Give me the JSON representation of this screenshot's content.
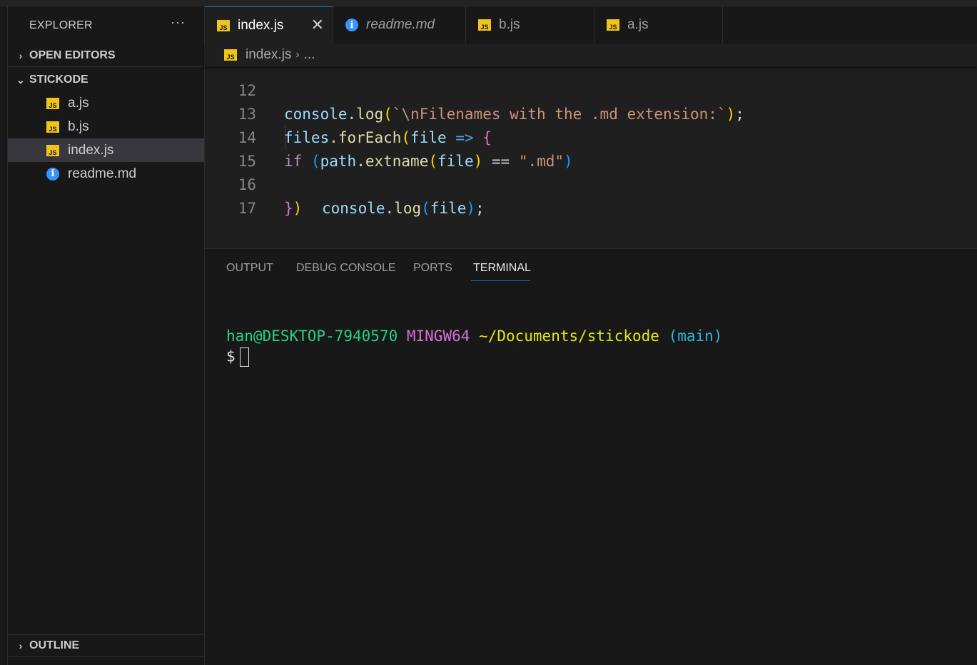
{
  "sidebar": {
    "title": "EXPLORER",
    "more_label": "···",
    "sections": {
      "open_editors": "OPEN EDITORS",
      "folder": "STICKODE",
      "outline": "OUTLINE"
    },
    "files": [
      {
        "name": "a.js",
        "type": "js",
        "selected": false
      },
      {
        "name": "b.js",
        "type": "js",
        "selected": false
      },
      {
        "name": "index.js",
        "type": "js",
        "selected": true
      },
      {
        "name": "readme.md",
        "type": "info",
        "selected": false
      }
    ]
  },
  "tabs": [
    {
      "label": "index.js",
      "icon": "js-file-icon",
      "active": true
    },
    {
      "label": "readme.md",
      "icon": "info-icon",
      "active": false
    },
    {
      "label": "b.js",
      "icon": "js-file-icon",
      "active": false
    },
    {
      "label": "a.js",
      "icon": "js-file-icon",
      "active": false
    }
  ],
  "icons": {
    "js": "JS",
    "info": "i",
    "close": "✕",
    "chevron_right": "›",
    "chevron_down": "⌄"
  },
  "breadcrumb": {
    "file": "index.js",
    "separator": "›",
    "more": "..."
  },
  "editor": {
    "lines": [
      {
        "n": "12",
        "text": "console.log(`\\nFilenames with the .md extension:`);"
      },
      {
        "n": "13",
        "text": "files.forEach(file => {"
      },
      {
        "n": "14",
        "text": "if (path.extname(file) == \".md\")"
      },
      {
        "n": "15",
        "text": "console.log(file);"
      },
      {
        "n": "16",
        "text": "})"
      },
      {
        "n": "17",
        "text": ""
      }
    ]
  },
  "panel": {
    "tabs": [
      "OUTPUT",
      "DEBUG CONSOLE",
      "PORTS",
      "TERMINAL"
    ],
    "active_tab": "TERMINAL",
    "terminal": {
      "user": "han@DESKTOP-7940570",
      "host": "MINGW64",
      "path": "~/Documents/stickode",
      "branch": "(main)",
      "prompt": "$"
    }
  },
  "colors": {
    "accent": "#0078d4",
    "js_icon": "#f0c419",
    "info_icon": "#3794ff"
  }
}
